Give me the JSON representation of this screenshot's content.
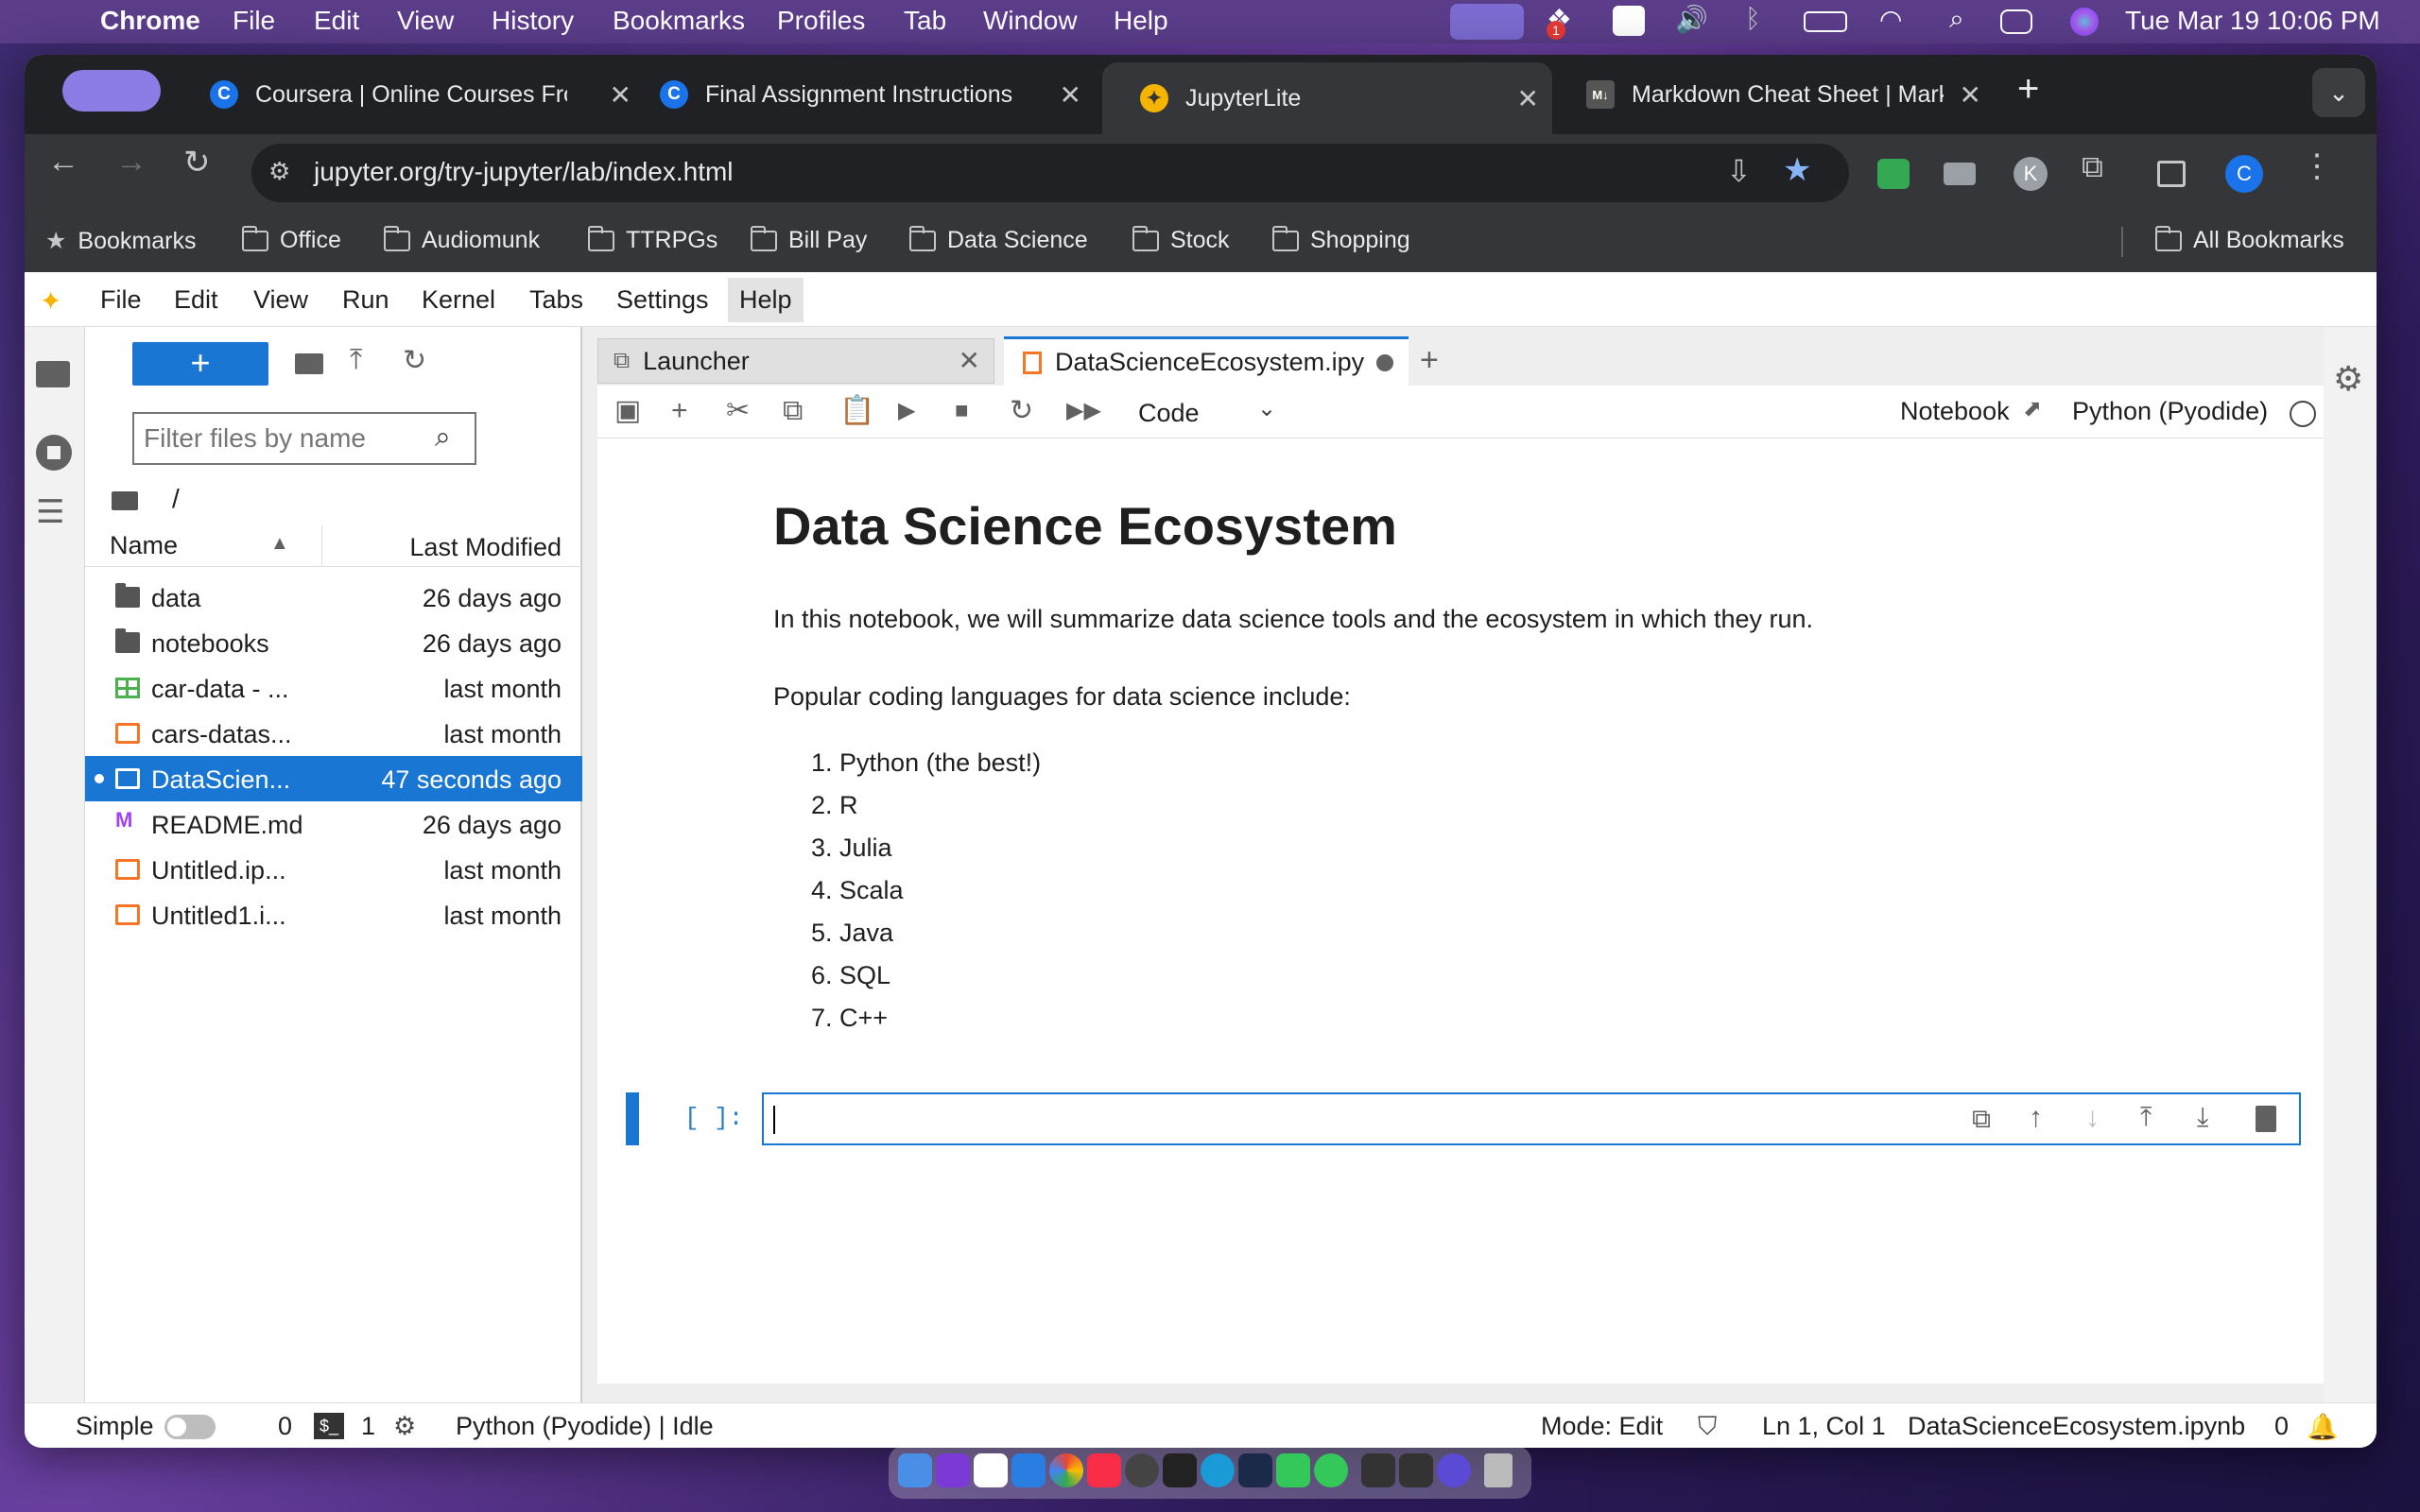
{
  "macos": {
    "app": "Chrome",
    "menu": [
      "File",
      "Edit",
      "View",
      "History",
      "Bookmarks",
      "Profiles",
      "Tab",
      "Window",
      "Help"
    ],
    "clock": "Tue Mar 19  10:06 PM",
    "dropbox_badge": "1"
  },
  "chrome": {
    "tabs": [
      {
        "title": "Coursera | Online Courses Fro",
        "favicon": "C"
      },
      {
        "title": "Final Assignment Instructions",
        "favicon": "C"
      },
      {
        "title": "JupyterLite",
        "favicon": "jupyter"
      },
      {
        "title": "Markdown Cheat Sheet | Mark",
        "favicon": "M↓"
      }
    ],
    "url": "jupyter.org/try-jupyter/lab/index.html",
    "profile_initial": "C",
    "ext_initial": "K",
    "bookmarks": [
      "Bookmarks",
      "Office",
      "Audiomunk",
      "TTRPGs",
      "Bill Pay",
      "Data Science",
      "Stock",
      "Shopping"
    ],
    "all_bookmarks": "All Bookmarks"
  },
  "jupyter": {
    "menu": [
      "File",
      "Edit",
      "View",
      "Run",
      "Kernel",
      "Tabs",
      "Settings",
      "Help"
    ],
    "filter_placeholder": "Filter files by name",
    "path": "/",
    "columns": {
      "name": "Name",
      "modified": "Last Modified"
    },
    "files": [
      {
        "name": "data",
        "modified": "26 days ago",
        "kind": "folder"
      },
      {
        "name": "notebooks",
        "modified": "26 days ago",
        "kind": "folder"
      },
      {
        "name": "car-data - ...",
        "modified": "last month",
        "kind": "csv"
      },
      {
        "name": "cars-datas...",
        "modified": "last month",
        "kind": "notebook"
      },
      {
        "name": "DataScien...",
        "modified": "47 seconds ago",
        "kind": "notebook",
        "selected": true
      },
      {
        "name": "README.md",
        "modified": "26 days ago",
        "kind": "markdown"
      },
      {
        "name": "Untitled.ip...",
        "modified": "last month",
        "kind": "notebook"
      },
      {
        "name": "Untitled1.i...",
        "modified": "last month",
        "kind": "notebook"
      }
    ],
    "tabs": [
      {
        "label": "Launcher"
      },
      {
        "label": "DataScienceEcosystem.ipy"
      }
    ],
    "cell_type": "Code",
    "notebook_link": "Notebook",
    "kernel_name": "Python (Pyodide)",
    "notebook": {
      "title": "Data Science Ecosystem",
      "intro": "In this notebook, we will summarize data science tools and the ecosystem in which they run.",
      "languages_heading": "Popular coding languages for data science include:",
      "languages": [
        "Python (the best!)",
        "R",
        "Julia",
        "Scala",
        "Java",
        "SQL",
        "C++"
      ],
      "prompt": "[ ]:"
    },
    "status": {
      "mode_label": "Simple",
      "terminals": "0",
      "kernels": "1",
      "kernel_status": "Python (Pyodide) | Idle",
      "mode": "Mode: Edit",
      "cursor": "Ln 1, Col 1",
      "filename": "DataScienceEcosystem.ipynb",
      "notifications": "0"
    }
  },
  "colors": {
    "accent": "#1976d2",
    "active_cell": "#1976d2",
    "notebook_orange": "#f37726"
  }
}
